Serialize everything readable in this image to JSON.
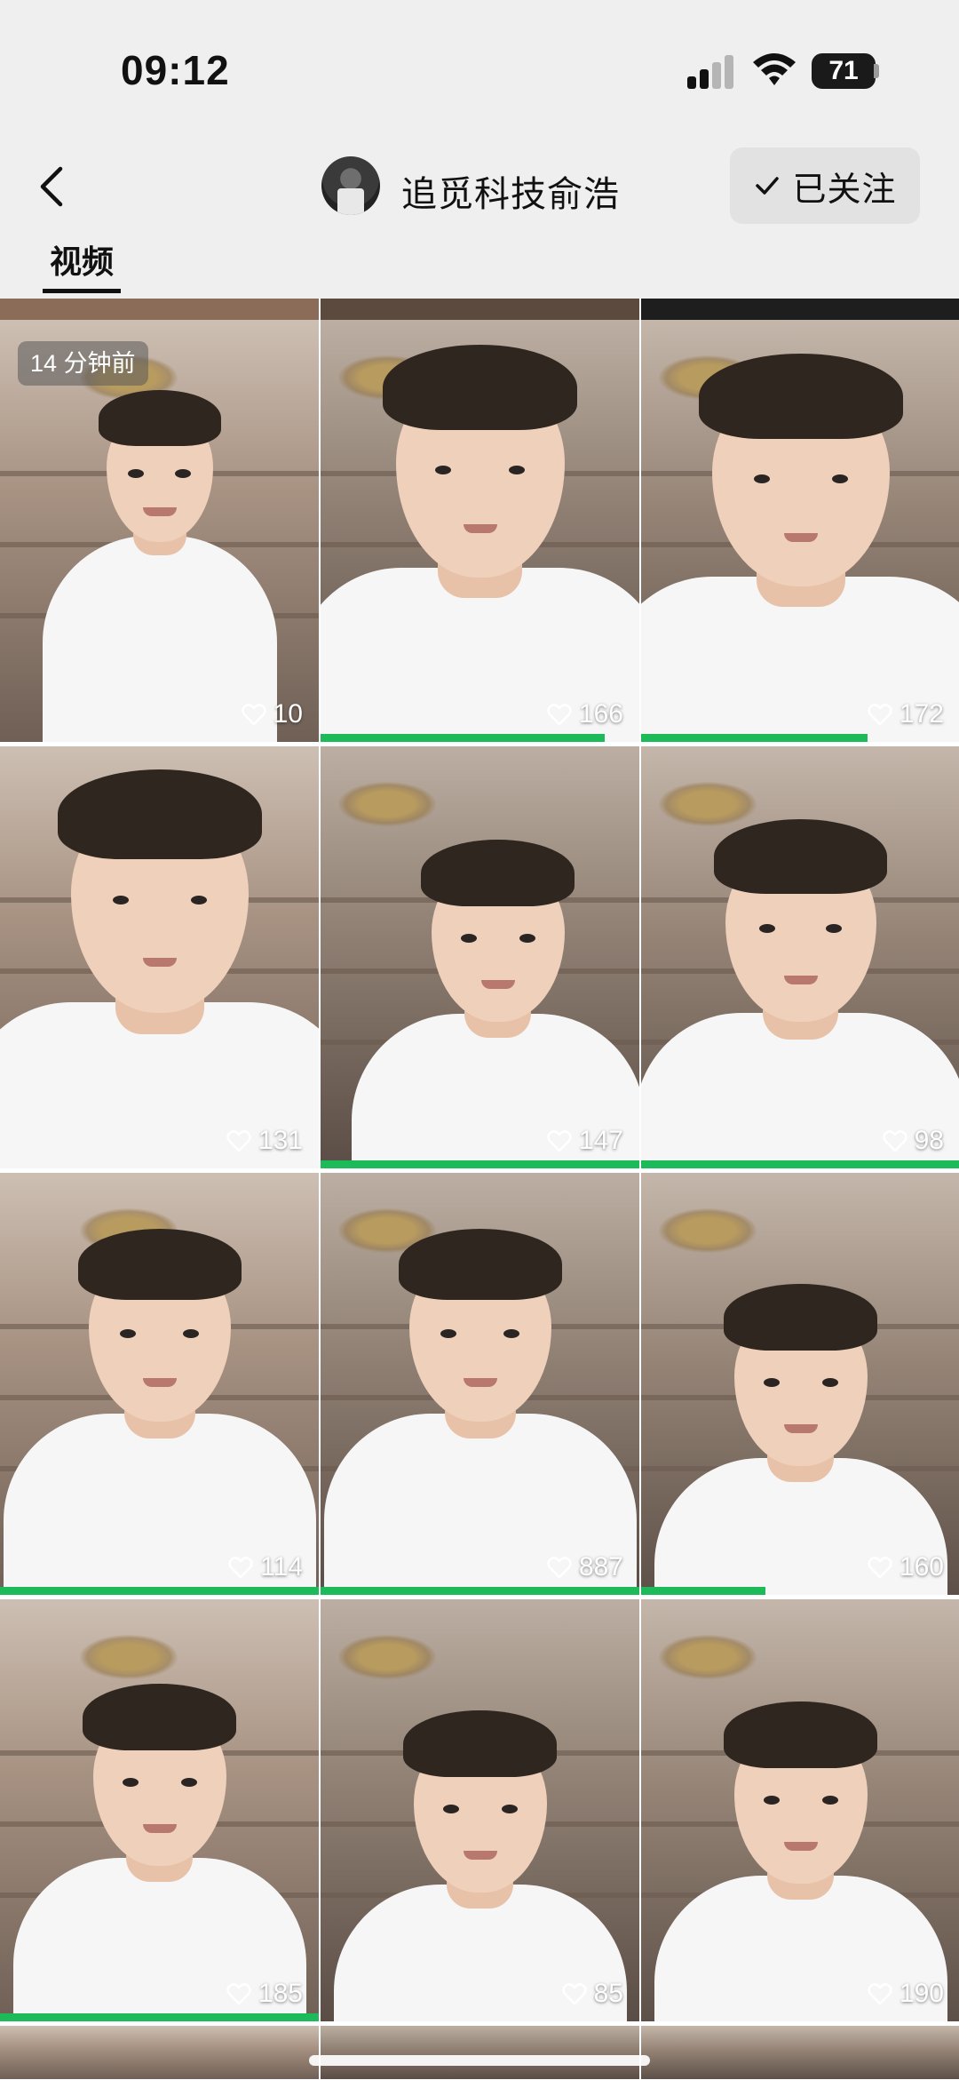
{
  "status_bar": {
    "time": "09:12",
    "battery": "71",
    "icons": [
      "signal-icon",
      "wifi-icon",
      "battery-icon"
    ]
  },
  "header": {
    "back_icon": "chevron-left-icon",
    "account_name": "追觅科技俞浩",
    "follow_label": "已关注",
    "follow_icon": "check-icon",
    "tab_label": "视频"
  },
  "colors": {
    "background": "#efefef",
    "progress": "#1dba5a",
    "follow_button": "#e2e2e2"
  },
  "videos": [
    {
      "likes": "10",
      "badge": "14 分钟前",
      "progress": 0
    },
    {
      "likes": "166",
      "progress": 0.89
    },
    {
      "likes": "172",
      "progress": 0.71
    },
    {
      "likes": "131",
      "progress": 0
    },
    {
      "likes": "147",
      "progress": 1.0
    },
    {
      "likes": "98",
      "progress": 1.0
    },
    {
      "likes": "114",
      "progress": 1.0
    },
    {
      "likes": "887",
      "progress": 1.0
    },
    {
      "likes": "160",
      "progress": 0.39
    },
    {
      "likes": "185",
      "progress": 1.0
    },
    {
      "likes": "85",
      "progress": 0
    },
    {
      "likes": "190",
      "progress": 0
    }
  ]
}
